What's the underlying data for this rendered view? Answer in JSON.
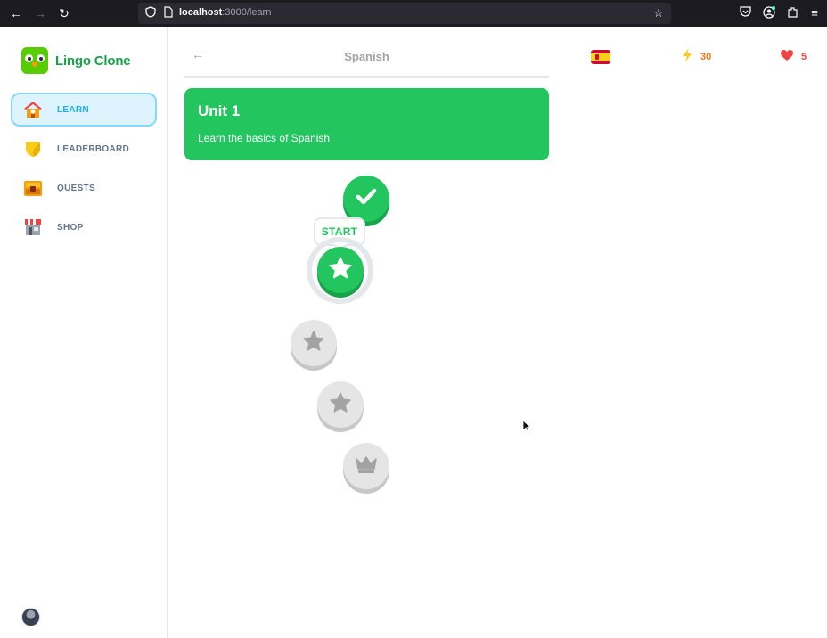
{
  "browser": {
    "url_host": "localhost",
    "url_path": ":3000/learn"
  },
  "sidebar": {
    "logo_text": "Lingo Clone",
    "items": [
      {
        "label": "LEARN",
        "icon": "house-icon",
        "active": true
      },
      {
        "label": "LEADERBOARD",
        "icon": "shield-icon",
        "active": false
      },
      {
        "label": "QUESTS",
        "icon": "treasure-chest-icon",
        "active": false
      },
      {
        "label": "SHOP",
        "icon": "shop-icon",
        "active": false
      }
    ]
  },
  "header": {
    "title": "Spanish"
  },
  "stats": {
    "course_flag": "spain-flag-icon",
    "points": "30",
    "hearts": "5"
  },
  "unit": {
    "title": "Unit 1",
    "description": "Learn the basics of Spanish"
  },
  "lessons": [
    {
      "status": "completed",
      "icon": "check-icon"
    },
    {
      "status": "current",
      "icon": "star-icon",
      "label": "START"
    },
    {
      "status": "locked",
      "icon": "star-icon"
    },
    {
      "status": "locked",
      "icon": "star-icon"
    },
    {
      "status": "locked",
      "icon": "crown-icon"
    }
  ],
  "colors": {
    "brand_green": "#22c55e",
    "active_blue": "#1cb0f6",
    "points_orange": "#ea7a1c",
    "hearts_red": "#ef4444",
    "locked_gray": "#e5e5e5"
  }
}
